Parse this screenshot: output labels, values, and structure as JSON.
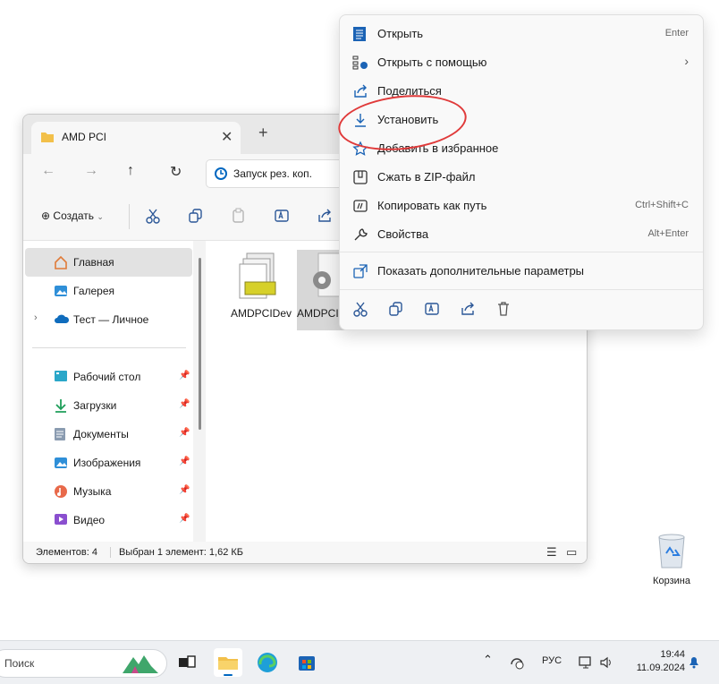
{
  "explorer": {
    "tab_title": "AMD PCI",
    "address": "Запуск рез. коп.",
    "create_label": "Создать",
    "nav": {
      "home": "Главная",
      "gallery": "Галерея",
      "cloud": "Тест — Личное",
      "desktop": "Рабочий стол",
      "downloads": "Загрузки",
      "documents": "Документы",
      "pictures": "Изображения",
      "music": "Музыка",
      "videos": "Видео"
    },
    "files": [
      {
        "name": "AMDPCIDev"
      },
      {
        "name": "AMDPCIDev"
      }
    ],
    "status": {
      "count": "Элементов: 4",
      "selection": "Выбран 1 элемент: 1,62 КБ"
    }
  },
  "context_menu": {
    "open": "Открыть",
    "open_shortcut": "Enter",
    "open_with": "Открыть с помощью",
    "share": "Поделиться",
    "install": "Установить",
    "favorite": "Добавить в избранное",
    "zip": "Сжать в ZIP-файл",
    "copy_path": "Копировать как путь",
    "copy_path_shortcut": "Ctrl+Shift+C",
    "properties": "Свойства",
    "properties_shortcut": "Alt+Enter",
    "more_options": "Показать дополнительные параметры"
  },
  "desktop": {
    "recycle_bin": "Корзина"
  },
  "taskbar": {
    "search_placeholder": "Поиск",
    "language": "РУС",
    "time": "19:44",
    "date": "11.09.2024"
  },
  "colors": {
    "accent": "#0067c0",
    "folder": "#f2c04a",
    "annotation": "#e03a3a"
  }
}
